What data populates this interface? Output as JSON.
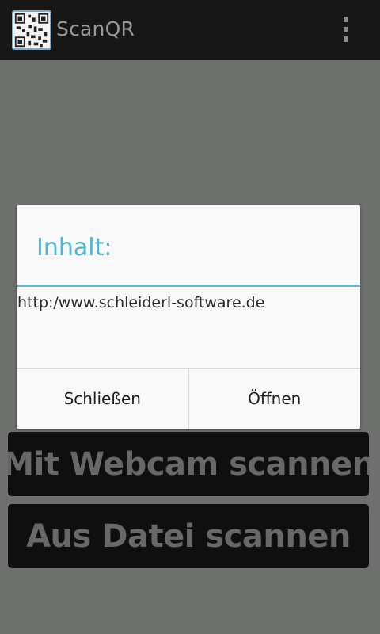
{
  "action_bar": {
    "app_title": "ScanQR",
    "app_icon": "qr-code-icon",
    "overflow_icon": "overflow-menu-icon"
  },
  "main": {
    "webcam_button": "Mit Webcam scannen",
    "file_button": "Aus Datei scannen"
  },
  "dialog": {
    "title": "Inhalt:",
    "message": "http:/www.schleiderl-software.de",
    "close_button": "Schließen",
    "open_button": "Öffnen"
  },
  "colors": {
    "action_bar_bg": "#171717",
    "screen_bg": "#6d706d",
    "accent": "#4db6d0",
    "big_button_bg": "#0f0f0f",
    "big_button_text": "#686868",
    "dialog_bg": "#f9f9f9"
  }
}
